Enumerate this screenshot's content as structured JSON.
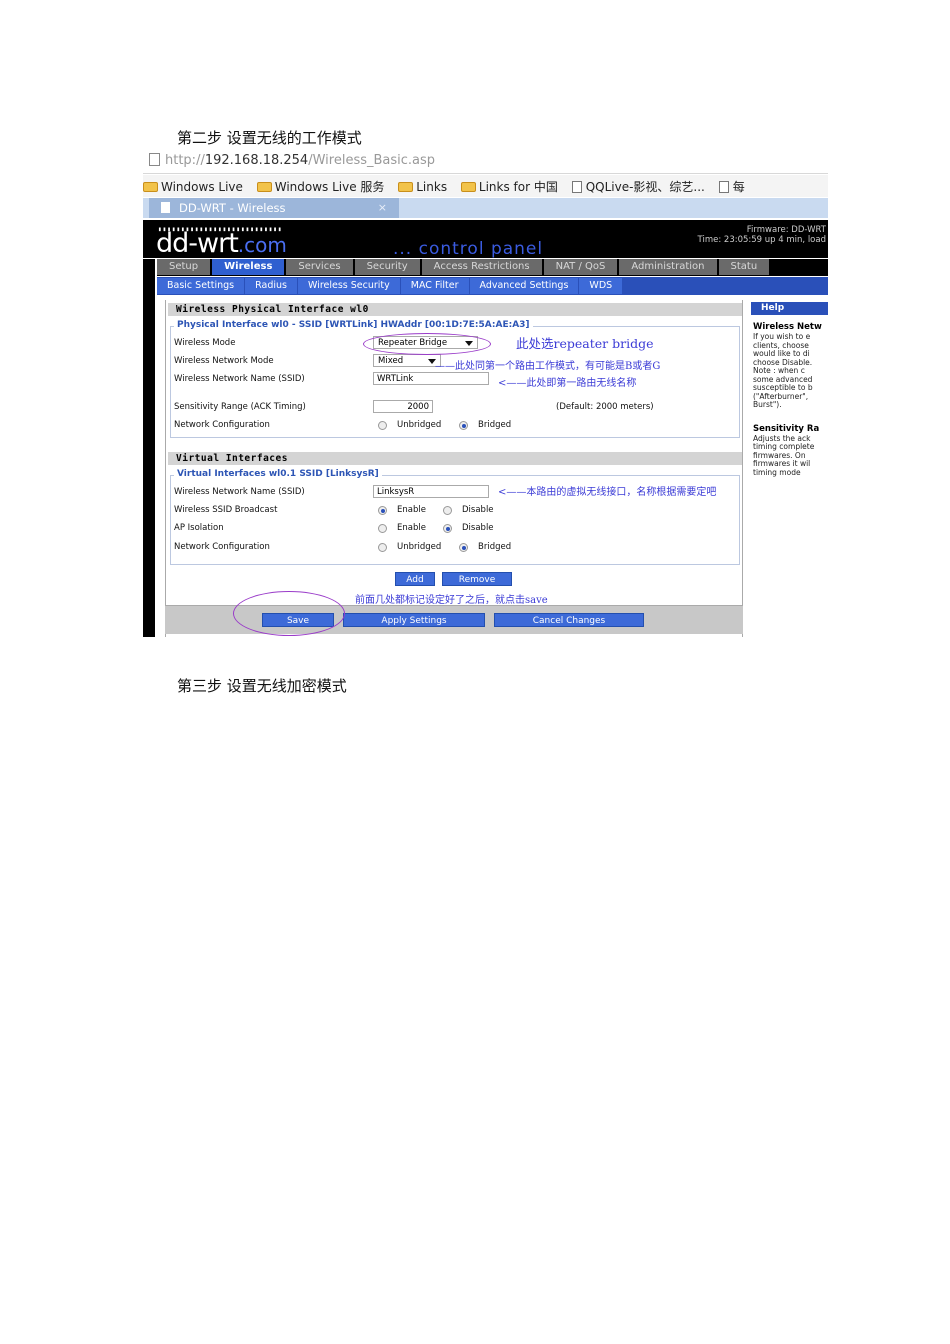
{
  "doc": {
    "step2": "第二步  设置无线的工作模式",
    "step3": "第三步  设置无线加密模式"
  },
  "browser": {
    "url_prefix": "http://",
    "url_host": "192.168.18.254",
    "url_path": "/Wireless_Basic.asp",
    "favorites": [
      "Windows Live",
      "Windows Live 服务",
      "Links",
      "Links for 中国",
      "QQLive-影视、综艺...",
      "每"
    ],
    "tab_title": "DD-WRT - Wireless",
    "tab_close": "×"
  },
  "header": {
    "dots": "▮▮▮▮▮▮▮▮▮▮▮▮▮▮▮▮▮▮▮▮▮▮▮▮▮▮▮",
    "logo_main": "dd-wrt",
    "logo_com": ".com",
    "control_panel": "... control panel",
    "firmware": "Firmware: DD-WRT",
    "time": "Time: 23:05:59 up 4 min, load"
  },
  "main_tabs": [
    "Setup",
    "Wireless",
    "Services",
    "Security",
    "Access Restrictions",
    "NAT / QoS",
    "Administration",
    "Statu"
  ],
  "sub_tabs": [
    "Basic Settings",
    "Radius",
    "Wireless Security",
    "MAC Filter",
    "Advanced Settings",
    "WDS"
  ],
  "physical": {
    "title": "Wireless Physical Interface wl0",
    "legend": "Physical Interface wl0 - SSID [WRTLink] HWAddr [00:1D:7E:5A:AE:A3]",
    "mode_label": "Wireless Mode",
    "mode_value": "Repeater Bridge",
    "netmode_label": "Wireless Network Mode",
    "netmode_value": "Mixed",
    "ssid_label": "Wireless Network Name (SSID)",
    "ssid_value": "WRTLink",
    "sens_label": "Sensitivity Range (ACK Timing)",
    "sens_value": "2000",
    "sens_default": "(Default: 2000 meters)",
    "netconf_label": "Network Configuration",
    "unbridged": "Unbridged",
    "bridged": "Bridged"
  },
  "virtual": {
    "title": "Virtual Interfaces",
    "legend": "Virtual Interfaces wl0.1 SSID [LinksysR]",
    "ssid_label": "Wireless Network Name (SSID)",
    "ssid_value": "LinksysR",
    "broadcast_label": "Wireless SSID Broadcast",
    "enable": "Enable",
    "disable": "Disable",
    "ap_label": "AP Isolation",
    "netconf_label": "Network Configuration",
    "unbridged": "Unbridged",
    "bridged": "Bridged"
  },
  "buttons": {
    "add": "Add",
    "remove": "Remove",
    "save": "Save",
    "apply": "Apply Settings",
    "cancel": "Cancel Changes"
  },
  "help": {
    "title": "Help",
    "h1": "Wireless Netw",
    "p1": [
      "If you wish to e",
      "clients, choose",
      "would like to di",
      "choose Disable.",
      "Note : when c",
      "some advanced",
      "susceptible to b",
      "(\"Afterburner\",",
      "Burst\")."
    ],
    "h2": "Sensitivity Ra",
    "p2": [
      "Adjusts the ack",
      "timing complete",
      "firmwares. On",
      "firmwares it wil",
      "timing mode"
    ]
  },
  "annotations": {
    "mode": "此处选repeater bridge",
    "netmode": "——此处同第一个路由工作模式，有可能是B或者G",
    "ssid": "<——此处即第一路由无线名称",
    "virtual": "<——本路由的虚拟无线接口，名称根据需要定吧",
    "save": "前面几处都标记设定好了之后，就点击save"
  }
}
